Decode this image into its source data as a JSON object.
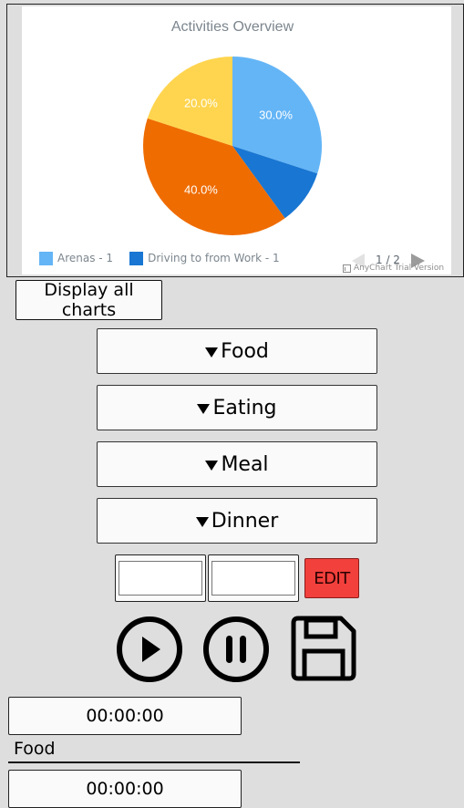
{
  "chart": {
    "title": "Activities Overview",
    "legend": [
      {
        "label": "Arenas - 1",
        "color": "#64b5f6"
      },
      {
        "label": "Driving to from Work - 1",
        "color": "#1976d2"
      }
    ],
    "pager": "1 / 2",
    "credits": "AnyChart Trial Version"
  },
  "chart_data": {
    "type": "pie",
    "title": "Activities Overview",
    "slices": [
      {
        "value": 30.0,
        "label": "30.0%",
        "color": "#64b5f6"
      },
      {
        "value": 10.0,
        "label": "",
        "color": "#1976d2"
      },
      {
        "value": 40.0,
        "label": "40.0%",
        "color": "#ef6c00"
      },
      {
        "value": 20.0,
        "label": "20.0%",
        "color": "#ffd54f"
      }
    ],
    "legend_position": "bottom-left"
  },
  "controls": {
    "display_all_label": "Display all charts",
    "categories": [
      "Food",
      "Eating",
      "Meal",
      "Dinner"
    ],
    "input_1_value": "",
    "input_2_value": "",
    "edit_label": "EDIT"
  },
  "icons": {
    "play": "play-circle-icon",
    "pause": "pause-circle-icon",
    "save": "floppy-disk-icon"
  },
  "timers": [
    {
      "time": "00:00:00",
      "label": "Food"
    },
    {
      "time": "00:00:00"
    }
  ]
}
